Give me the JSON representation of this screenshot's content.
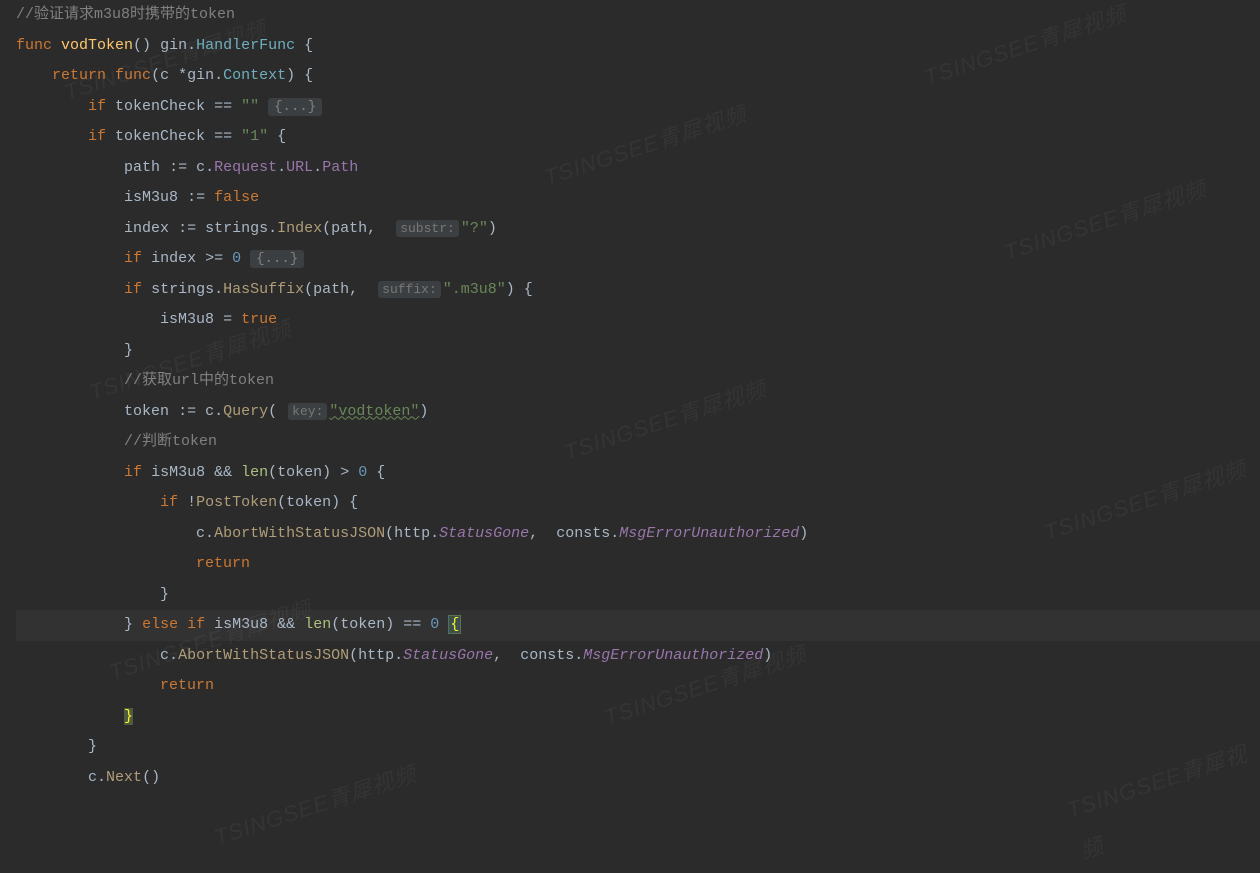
{
  "watermark": "TSINGSEE青犀视频",
  "code": {
    "l1_comment": "//验证请求m3u8时携带的token",
    "l2_func": "func",
    "l2_name": "vodToken",
    "l2_parens": "()",
    "l2_gin": "gin",
    "l2_handler": "HandlerFunc",
    "l3_return": "return",
    "l3_func": "func",
    "l3_c": "c",
    "l3_star": "*",
    "l3_gin": "gin",
    "l3_ctx": "Context",
    "l4_if": "if",
    "l4_tokenCheck": "tokenCheck",
    "l4_eq": "==",
    "l4_empty": "\"\"",
    "l4_fold": "{...}",
    "l5_if": "if",
    "l5_tokenCheck": "tokenCheck",
    "l5_eq": "==",
    "l5_one": "\"1\"",
    "l6_path": "path",
    "l6_assign": ":=",
    "l6_c": "c",
    "l6_Request": "Request",
    "l6_URL": "URL",
    "l6_Path": "Path",
    "l7_isM3u8": "isM3u8",
    "l7_assign": ":=",
    "l7_false": "false",
    "l8_index": "index",
    "l8_assign": ":=",
    "l8_strings": "strings",
    "l8_Index": "Index",
    "l8_path": "path",
    "l8_hint": "substr:",
    "l8_q": "\"?\"",
    "l9_if": "if",
    "l9_index": "index",
    "l9_gte": ">=",
    "l9_zero": "0",
    "l9_fold": "{...}",
    "l10_if": "if",
    "l10_strings": "strings",
    "l10_HasSuffix": "HasSuffix",
    "l10_path": "path",
    "l10_hint": "suffix:",
    "l10_m3u8": "\".m3u8\"",
    "l11_isM3u8": "isM3u8",
    "l11_eq": "=",
    "l11_true": "true",
    "l13_comment": "//获取url中的token",
    "l14_token": "token",
    "l14_assign": ":=",
    "l14_c": "c",
    "l14_Query": "Query",
    "l14_hint": "key:",
    "l14_vodtoken": "\"vodtoken\"",
    "l15_comment": "//判断token",
    "l16_if": "if",
    "l16_isM3u8": "isM3u8",
    "l16_and": "&&",
    "l16_len": "len",
    "l16_token": "token",
    "l16_gt": ">",
    "l16_zero": "0",
    "l17_if": "if",
    "l17_not": "!",
    "l17_PostToken": "PostToken",
    "l17_token": "token",
    "l18_c": "c",
    "l18_Abort": "AbortWithStatusJSON",
    "l18_http": "http",
    "l18_StatusGone": "StatusGone",
    "l18_consts": "consts",
    "l18_Msg": "MsgErrorUnauthorized",
    "l19_return": "return",
    "l21_else": "else",
    "l21_if": "if",
    "l21_isM3u8": "isM3u8",
    "l21_and": "&&",
    "l21_len": "len",
    "l21_token": "token",
    "l21_eqeq": "==",
    "l21_zero": "0",
    "l22_c": "c",
    "l22_Abort": "AbortWithStatusJSON",
    "l22_http": "http",
    "l22_StatusGone": "StatusGone",
    "l22_consts": "consts",
    "l22_Msg": "MsgErrorUnauthorized",
    "l23_return": "return",
    "l26_c": "c",
    "l26_Next": "Next"
  }
}
